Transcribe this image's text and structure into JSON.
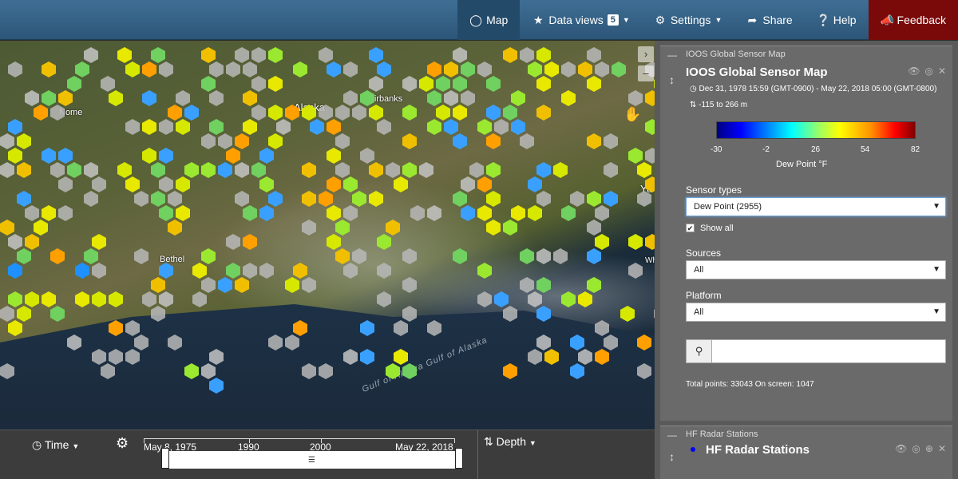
{
  "nav": {
    "items": [
      {
        "label": "Map",
        "icon": "globe-icon",
        "active": true
      },
      {
        "label": "Data views",
        "icon": "star-icon",
        "badge": "5",
        "caret": true
      },
      {
        "label": "Settings",
        "icon": "gear-icon",
        "caret": true
      },
      {
        "label": "Share",
        "icon": "share-icon"
      },
      {
        "label": "Help",
        "icon": "question-icon"
      },
      {
        "label": "Feedback",
        "icon": "bullhorn-icon"
      }
    ],
    "colors": {
      "bar": "#2c5678",
      "feedback": "#7a0a0a"
    }
  },
  "map": {
    "labels": [
      "Alaska",
      "Fairbanks",
      "Nome",
      "Bethel",
      "Yu",
      "Wh"
    ],
    "water_label": "Gulf of Alaska  Gulf of Alaska",
    "controls": {
      "expand_icon": "chevron-right-icon",
      "collapse_icon": "minus-icon"
    }
  },
  "timebar": {
    "time_label": "Time",
    "depth_label": "Depth",
    "ticks": [
      "May 8, 1975",
      "1990",
      "2000",
      "May 22, 2018"
    ]
  },
  "layer1": {
    "header": "IOOS Global Sensor Map",
    "title": "IOOS Global Sensor Map",
    "date_range": "Dec 31, 1978 15:59 (GMT-0900) - May 22, 2018 05:00 (GMT-0800)",
    "depth_range": "-115 to 266 m",
    "colorbar_ticks": [
      "-30",
      "-2",
      "26",
      "54",
      "82"
    ],
    "colorbar_units": "Dew Point °F",
    "sensor_types_label": "Sensor types",
    "sensor_type_value": "Dew Point (2955)",
    "show_all_label": "Show all",
    "show_all_checked": true,
    "sources_label": "Sources",
    "sources_value": "All",
    "platform_label": "Platform",
    "platform_value": "All",
    "search_placeholder": "",
    "totals": "Total points: 33043 On screen: 1047"
  },
  "layer2": {
    "header": "HF Radar Stations",
    "title": "HF Radar Stations"
  }
}
